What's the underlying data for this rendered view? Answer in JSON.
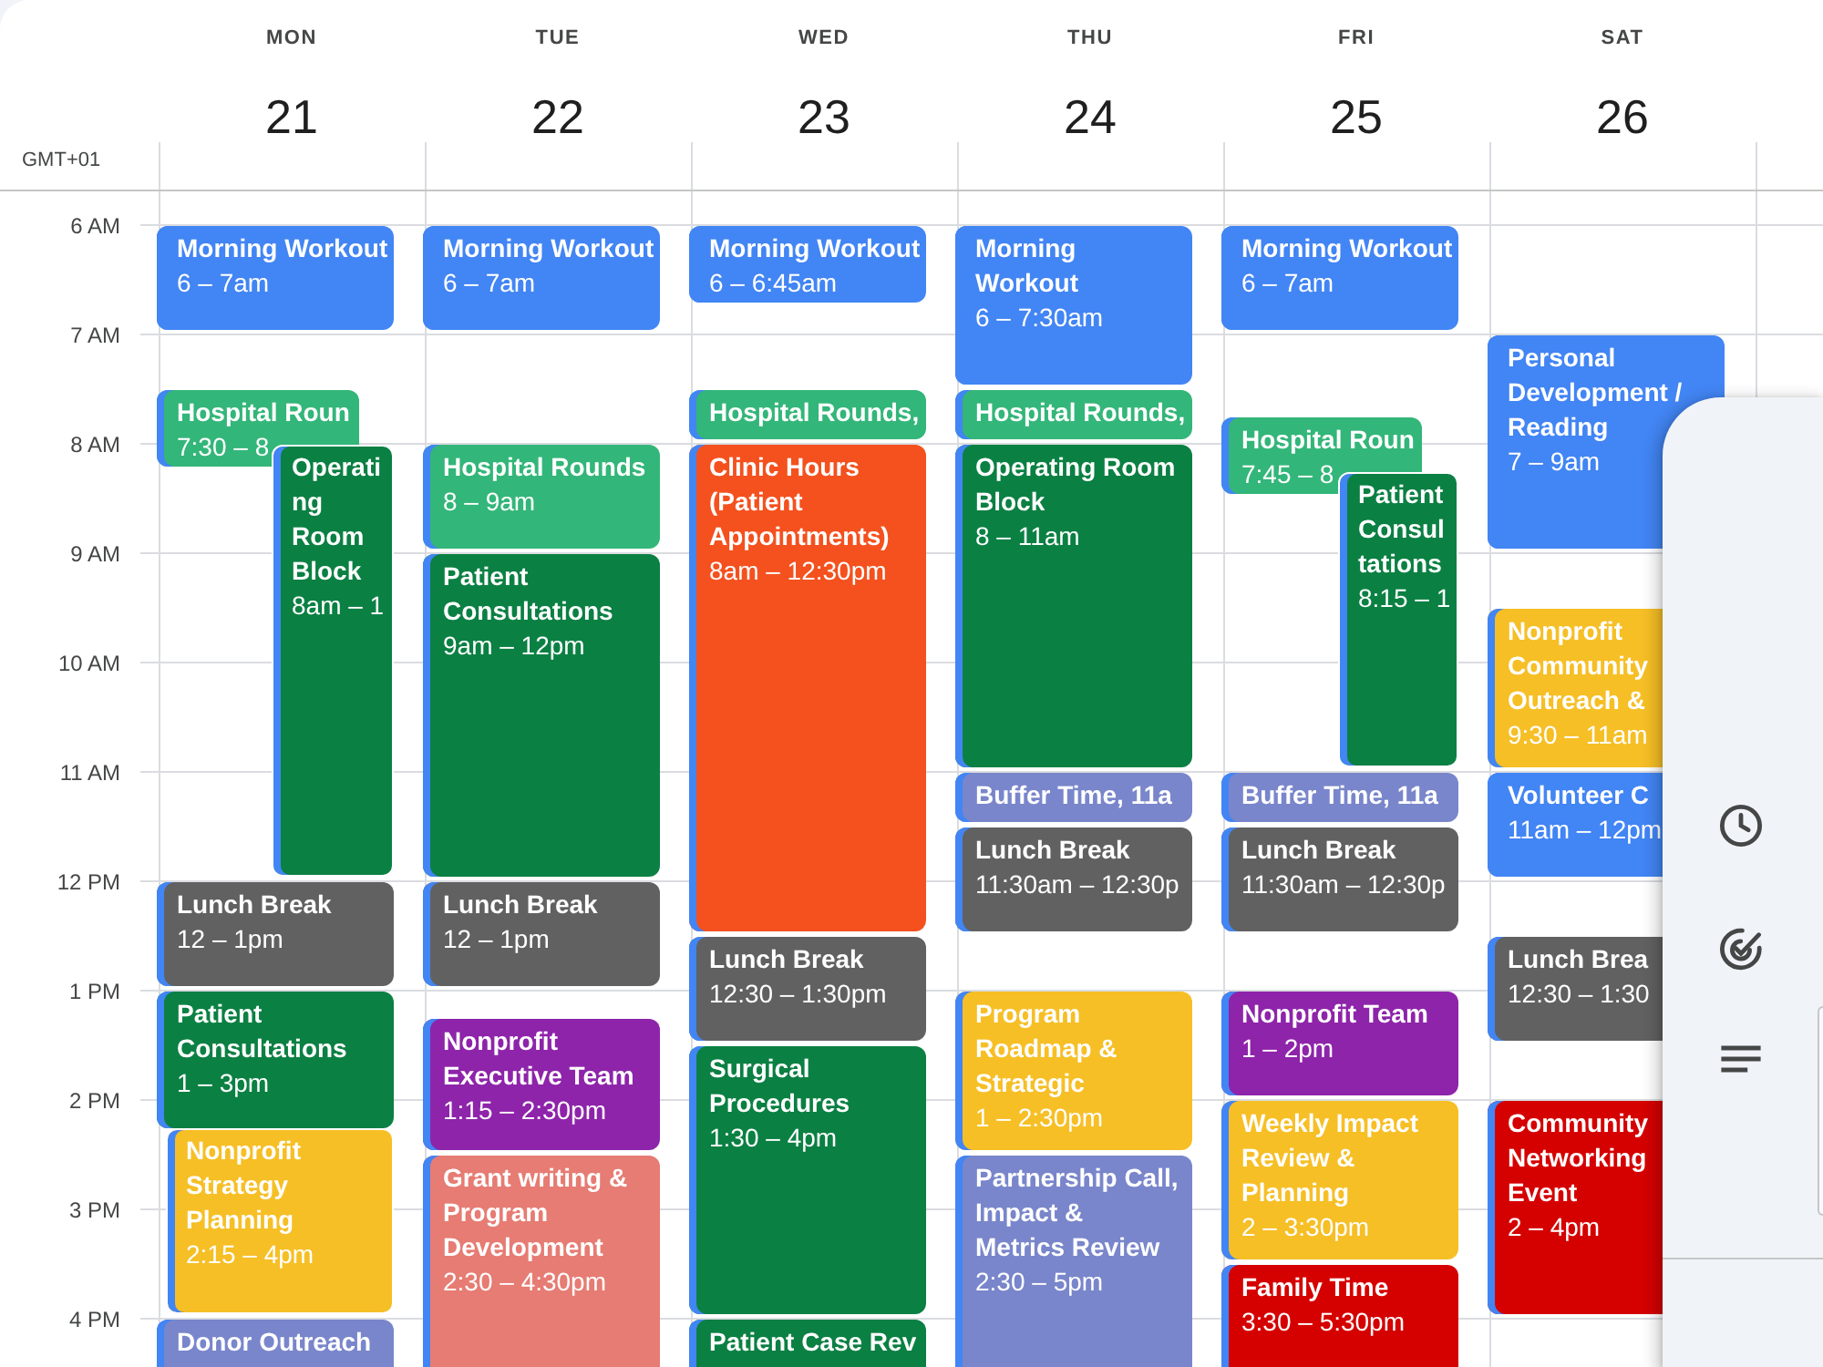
{
  "timezone": "GMT+01",
  "days": [
    {
      "name": "MON",
      "date": "21",
      "events": [
        {
          "title": "Morning Workout",
          "time": "6 – 7am",
          "color": "#4285f4"
        },
        {
          "title": "Hospital Roun",
          "time": "7:30 – 8",
          "color": "#33b679"
        },
        {
          "title": "Operating Room Block",
          "time": "8am – 1",
          "color": "#0b8043"
        },
        {
          "title": "Lunch Break",
          "time": "12 – 1pm",
          "color": "#616161"
        },
        {
          "title": "Patient Consultations",
          "time": "1 – 3pm",
          "color": "#0b8043"
        },
        {
          "title": "Nonprofit Strategy Planning",
          "time": "2:15 – 4pm",
          "color": "#f6bf26"
        },
        {
          "title": "Donor Outreach",
          "color": "#7986cb"
        }
      ]
    },
    {
      "name": "TUE",
      "date": "22",
      "events": [
        {
          "title": "Morning Workout",
          "time": "6 – 7am",
          "color": "#4285f4"
        },
        {
          "title": "Hospital Rounds",
          "time": "8 – 9am",
          "color": "#33b679"
        },
        {
          "title": "Patient Consultations",
          "time": "9am – 12pm",
          "color": "#0b8043"
        },
        {
          "title": "Lunch Break",
          "time": "12 – 1pm",
          "color": "#616161"
        },
        {
          "title": "Nonprofit Executive Team",
          "time": "1:15 – 2:30pm",
          "color": "#8e24aa"
        },
        {
          "title": "Grant writing & Program Development",
          "time": "2:30 – 4:30pm",
          "color": "#e67c73"
        }
      ]
    },
    {
      "name": "WED",
      "date": "23",
      "events": [
        {
          "title": "Morning Workout",
          "time": "6 – 6:45am",
          "color": "#4285f4"
        },
        {
          "title": "Hospital Rounds,",
          "color": "#33b679"
        },
        {
          "title": "Clinic Hours (Patient Appointments)",
          "time": "8am – 12:30pm",
          "color": "#f4511e"
        },
        {
          "title": "Lunch Break",
          "time": "12:30 – 1:30pm",
          "color": "#616161"
        },
        {
          "title": "Surgical Procedures",
          "time": "1:30 – 4pm",
          "color": "#0b8043"
        },
        {
          "title": "Patient Case Rev",
          "color": "#0b8043"
        }
      ]
    },
    {
      "name": "THU",
      "date": "24",
      "events": [
        {
          "title": "Morning Workout",
          "time": "6 – 7:30am",
          "color": "#4285f4"
        },
        {
          "title": "Hospital Rounds,",
          "color": "#33b679"
        },
        {
          "title": "Operating Room Block",
          "time": "8 – 11am",
          "color": "#0b8043"
        },
        {
          "title": "Buffer Time, 11a",
          "color": "#7986cb"
        },
        {
          "title": "Lunch Break",
          "time": "11:30am – 12:30p",
          "color": "#616161"
        },
        {
          "title": "Program Roadmap & Strategic",
          "time": "1 – 2:30pm",
          "color": "#f6bf26"
        },
        {
          "title": "Partnership Call, Impact & Metrics Review",
          "time": "2:30 – 5pm",
          "color": "#7986cb"
        }
      ]
    },
    {
      "name": "FRI",
      "date": "25",
      "events": [
        {
          "title": "Morning Workout",
          "time": "6 – 7am",
          "color": "#4285f4"
        },
        {
          "title": "Hospital Roun",
          "time": "7:45 – 8",
          "color": "#33b679"
        },
        {
          "title": "Patient Consultations",
          "time": "8:15 – 1",
          "color": "#0b8043"
        },
        {
          "title": "Buffer Time, 11a",
          "color": "#7986cb"
        },
        {
          "title": "Lunch Break",
          "time": "11:30am – 12:30p",
          "color": "#616161"
        },
        {
          "title": "Nonprofit Team",
          "time": "1 – 2pm",
          "color": "#8e24aa"
        },
        {
          "title": "Weekly Impact Review & Planning",
          "time": "2 – 3:30pm",
          "color": "#f6bf26"
        },
        {
          "title": "Family Time",
          "time": "3:30 – 5:30pm",
          "color": "#d50000"
        }
      ]
    },
    {
      "name": "SAT",
      "date": "26",
      "events": [
        {
          "title": "Personal Development / Reading",
          "time": "7 – 9am",
          "color": "#4285f4"
        },
        {
          "title": "Nonprofit Community Outreach &",
          "time": "9:30 – 11am",
          "color": "#f6bf26"
        },
        {
          "title": "Volunteer C",
          "time": "11am – 12pm",
          "color": "#4285f4"
        },
        {
          "title": "Lunch Brea",
          "time": "12:30 – 1:30",
          "color": "#616161"
        },
        {
          "title": "Community Networking Event",
          "time": "2 – 4pm",
          "color": "#d50000"
        }
      ]
    }
  ],
  "time_labels": [
    "6 AM",
    "7 AM",
    "8 AM",
    "9 AM",
    "10 AM",
    "11 AM",
    "12 PM",
    "1 PM",
    "2 PM",
    "3 PM",
    "4 PM"
  ]
}
